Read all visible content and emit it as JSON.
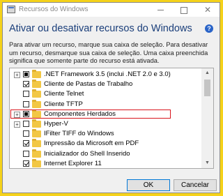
{
  "window": {
    "title": "Recursos do Windows",
    "heading": "Ativar ou desativar recursos do Windows",
    "description": "Para ativar um recurso, marque sua caixa de seleção. Para desativar um recurso, desmarque sua caixa de seleção. Uma caixa preenchida significa que somente parte do recurso está ativada.",
    "help_label": "?",
    "minimize_icon": "minimize-icon",
    "maximize_icon": "maximize-icon",
    "close_label": "✕"
  },
  "features": [
    {
      "label": ".NET Framework 3.5 (inclui .NET 2.0 e 3.0)",
      "state": "partial",
      "expandable": true
    },
    {
      "label": "Cliente de Pastas de Trabalho",
      "state": "checked",
      "expandable": false
    },
    {
      "label": "Cliente Telnet",
      "state": "unchecked",
      "expandable": false
    },
    {
      "label": "Cliente TFTP",
      "state": "unchecked",
      "expandable": false
    },
    {
      "label": "Componentes Herdados",
      "state": "partial",
      "expandable": true,
      "highlighted": true
    },
    {
      "label": "Hyper-V",
      "state": "unchecked",
      "expandable": true
    },
    {
      "label": "IFilter TIFF do Windows",
      "state": "unchecked",
      "expandable": false
    },
    {
      "label": "Impressão da Microsoft em PDF",
      "state": "checked",
      "expandable": false
    },
    {
      "label": "Inicializador do Shell Inserido",
      "state": "unchecked",
      "expandable": false
    },
    {
      "label": "Internet Explorer 11",
      "state": "checked",
      "expandable": false
    }
  ],
  "buttons": {
    "ok": "OK",
    "cancel": "Cancelar"
  },
  "colors": {
    "highlight": "#d8141c",
    "heading": "#1a3e7a",
    "folder": "#f2c744",
    "background": "#f5d21a"
  }
}
